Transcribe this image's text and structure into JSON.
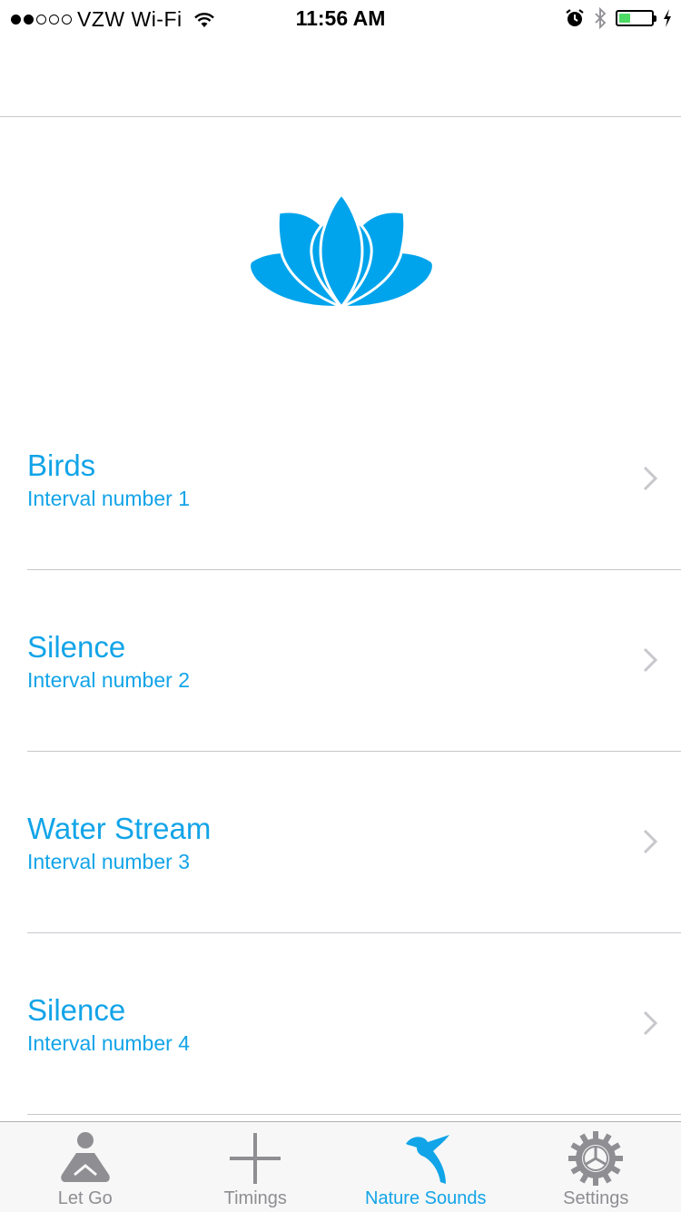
{
  "status_bar": {
    "signal_bars_filled": 2,
    "signal_bars_total": 5,
    "carrier": "VZW Wi-Fi",
    "time": "11:56 AM",
    "battery_level": 0.35,
    "icons": [
      "wifi-icon",
      "alarm-icon",
      "bluetooth-icon",
      "battery-icon",
      "charging-icon"
    ]
  },
  "logo": {
    "icon": "lotus-icon",
    "color": "#00a4ec"
  },
  "intervals": [
    {
      "title": "Birds",
      "subtitle": "Interval number 1"
    },
    {
      "title": "Silence",
      "subtitle": "Interval number 2"
    },
    {
      "title": "Water Stream",
      "subtitle": "Interval number 3"
    },
    {
      "title": "Silence",
      "subtitle": "Interval number 4"
    }
  ],
  "tab_bar": {
    "tabs": [
      {
        "label": "Let Go",
        "icon": "meditation-icon",
        "active": false
      },
      {
        "label": "Timings",
        "icon": "plus-icon",
        "active": false
      },
      {
        "label": "Nature Sounds",
        "icon": "bird-icon",
        "active": true
      },
      {
        "label": "Settings",
        "icon": "gear-icon",
        "active": false
      }
    ]
  },
  "colors": {
    "accent": "#12a4e8",
    "inactive_tab": "#8e8e93",
    "separator": "#c8c7cc",
    "battery": "#4cd964"
  }
}
